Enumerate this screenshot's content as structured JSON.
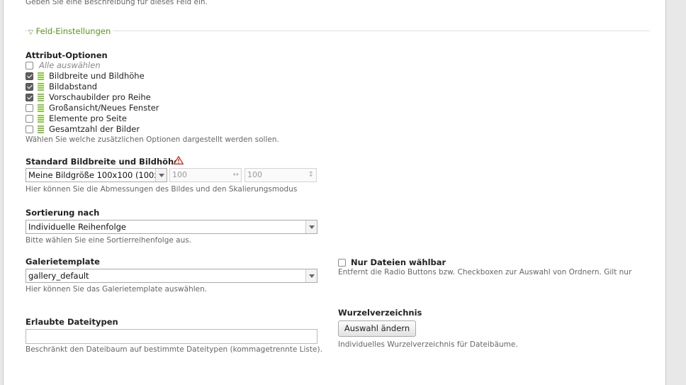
{
  "top_help": "Geben Sie eine Beschreibung für dieses Feld ein.",
  "section": {
    "toggle_icon": "triangle-down-icon",
    "legend": "Feld-Einstellungen"
  },
  "attribute_options": {
    "label": "Attribut-Optionen",
    "select_all": "Alle auswählen",
    "items": [
      {
        "label": "Bildbreite und Bildhöhe",
        "checked": true
      },
      {
        "label": "Bildabstand",
        "checked": true
      },
      {
        "label": "Vorschaubilder pro Reihe",
        "checked": true
      },
      {
        "label": "Großansicht/Neues Fenster",
        "checked": false
      },
      {
        "label": "Elemente pro Seite",
        "checked": false
      },
      {
        "label": "Gesamtzahl der Bilder",
        "checked": false
      }
    ],
    "help": "Wählen Sie welche zusätzlichen Optionen dargestellt werden sollen."
  },
  "size": {
    "label": "Standard Bildbreite und Bildhöhe",
    "warning_icon": "warning-icon",
    "select_value": "Meine Bildgröße 100x100 (100x10",
    "width_placeholder": "100",
    "height_placeholder": "100",
    "width_icon": "↔",
    "height_icon": "↕",
    "help": "Hier können Sie die Abmessungen des Bildes und den Skalierungsmodus"
  },
  "sort": {
    "label": "Sortierung nach",
    "value": "Individuelle Reihenfolge",
    "help": "Bitte wählen Sie eine Sortierreihenfolge aus."
  },
  "gallery": {
    "label": "Galerietemplate",
    "value": "gallery_default",
    "help": "Hier können Sie das Galerietemplate auswählen."
  },
  "files_only": {
    "label": "Nur Dateien wählbar",
    "checked": false,
    "help": "Entfernt die Radio Buttons bzw. Checkboxen zur Auswahl von Ordnern. Gilt nur"
  },
  "root": {
    "label": "Wurzelverzeichnis",
    "button": "Auswahl ändern",
    "help": "Individuelles Wurzelverzeichnis für Dateibäume."
  },
  "types": {
    "label": "Erlaubte Dateitypen",
    "value": "",
    "help": "Beschränkt den Dateibaum auf bestimmte Dateitypen (kommagetrennte Liste)."
  }
}
